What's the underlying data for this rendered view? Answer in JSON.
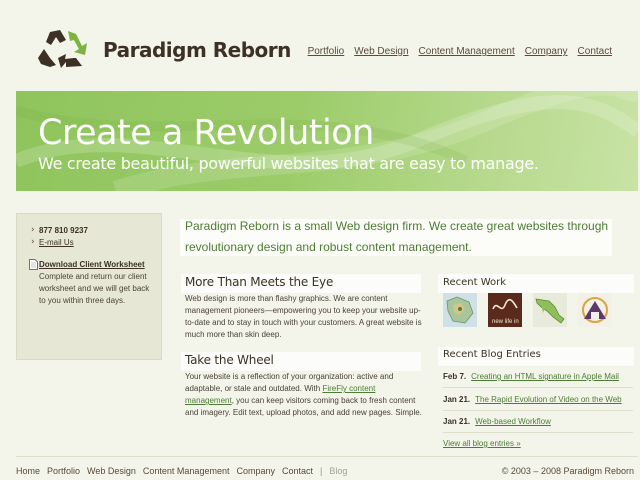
{
  "brand": {
    "name": "Paradigm Reborn",
    "logo_icon": "recycle-icon",
    "accent_green": "#8fc45c",
    "link_green": "#4d7d34",
    "logo_brown": "#3c3124"
  },
  "nav": {
    "items": [
      "Portfolio",
      "Web Design",
      "Content Management",
      "Company",
      "Contact"
    ]
  },
  "banner": {
    "title": "Create a Revolution",
    "subtitle": "We create beautiful, powerful websites that are easy to manage."
  },
  "sidebar": {
    "phone": "877 810 9237",
    "email_label": "E-mail Us",
    "download_label": "Download Client Worksheet",
    "download_desc": "Complete and return our client worksheet and we will get back to you within three days."
  },
  "intro": "Paradigm Reborn is a small Web design firm. We create great websites through revolutionary design and robust content management.",
  "sections": [
    {
      "heading": "More Than Meets the Eye",
      "body": "Web design is more than flashy graphics. We are content management pioneers—empowering you to keep your website up-to-date and to stay in touch with your customers. A great website is much more than skin deep."
    },
    {
      "heading": "Take the Wheel",
      "body_before": "Your website is a reflection of your organization: active and adaptable, or stale and outdated. With ",
      "link": "FireFly content management",
      "body_after": ", you can keep visitors coming back to fresh content and imagery. Edit text, upload photos, and add new pages. Simple."
    }
  ],
  "recent_work": {
    "heading": "Recent Work",
    "thumbs": [
      {
        "icon": "map-icon"
      },
      {
        "icon": "signature-icon",
        "caption": "new life in"
      },
      {
        "icon": "mexico-map-icon"
      },
      {
        "icon": "house-logo-icon"
      }
    ]
  },
  "blog": {
    "heading": "Recent Blog Entries",
    "entries": [
      {
        "date": "Feb 7.",
        "title": "Creating an HTML signature in Apple Mail"
      },
      {
        "date": "Jan 21.",
        "title": "The Rapid Evolution of Video on the Web"
      },
      {
        "date": "Jan 21.",
        "title": "Web-based Workflow"
      }
    ],
    "view_all": "View all blog entries »"
  },
  "footer": {
    "links": [
      "Home",
      "Portfolio",
      "Web Design",
      "Content Management",
      "Company",
      "Contact"
    ],
    "separator": "|",
    "blog": "Blog",
    "copyright": "© 2003 – 2008 Paradigm Reborn"
  }
}
